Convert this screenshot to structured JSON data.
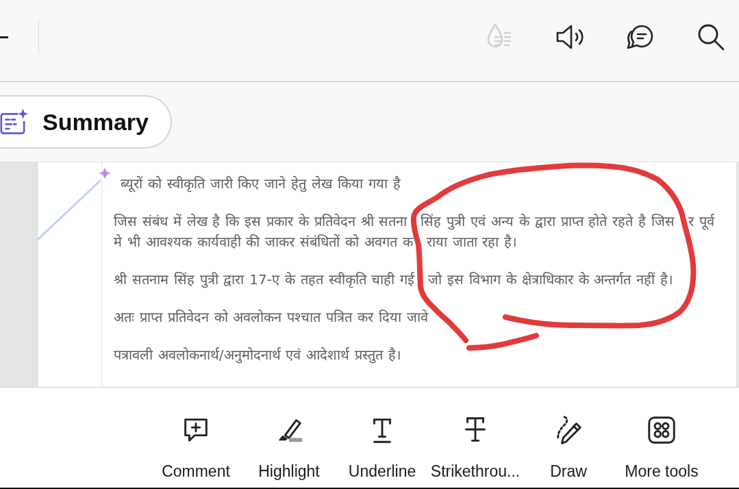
{
  "top_bar": {
    "actions": [
      {
        "kind": "contrast",
        "disabled": true
      },
      {
        "kind": "read-aloud",
        "disabled": false
      },
      {
        "kind": "comments",
        "disabled": false
      },
      {
        "kind": "search",
        "disabled": false
      }
    ]
  },
  "summary_button": {
    "label": "Summary"
  },
  "document": {
    "paragraphs": [
      {
        "lines": [
          {
            "segments": [
              "ब्यूरों को स्वीकृति जारी किए जाने हेतु लेख किया गया है"
            ]
          }
        ]
      },
      {
        "lines": [
          {
            "segments": [
              "जिस संबंध में लेख है कि इस प्रकार के प्रतिवेदन श्री सतना",
              "सिंह पुत्री एवं अन्य के द्वारा प्राप्त होते रहते है जिस",
              "र पूर्व"
            ]
          },
          {
            "segments": [
              "मे भी आवश्यक कार्यवाही की जाकर संबंधितों को अवगत क",
              "राया जाता रहा है।"
            ]
          }
        ]
      },
      {
        "lines": [
          {
            "segments": [
              "श्री सतनाम सिंह पुत्री द्वारा 17-ए के तहत स्वीकृति चाही गई",
              "जो इस विभाग के क्षेत्राधिकार के अन्तर्गत नहीं है।"
            ]
          }
        ]
      },
      {
        "lines": [
          {
            "segments": [
              "अतः प्राप्त प्रतिवेदन को अवलोकन पश्चात पत्रित कर दिया जावे"
            ]
          }
        ]
      },
      {
        "lines": [
          {
            "segments": [
              "पत्रावली अवलोकनार्थ/अनुमोदनार्थ एवं आदेशार्थ प्रस्तुत है।"
            ]
          }
        ]
      }
    ]
  },
  "tools": [
    {
      "kind": "comment",
      "label": "Comment"
    },
    {
      "kind": "highlight",
      "label": "Highlight"
    },
    {
      "kind": "underline",
      "label": "Underline"
    },
    {
      "kind": "strikethrough",
      "label": "Strikethrou..."
    },
    {
      "kind": "draw",
      "label": "Draw"
    },
    {
      "kind": "more",
      "label": "More tools"
    }
  ]
}
